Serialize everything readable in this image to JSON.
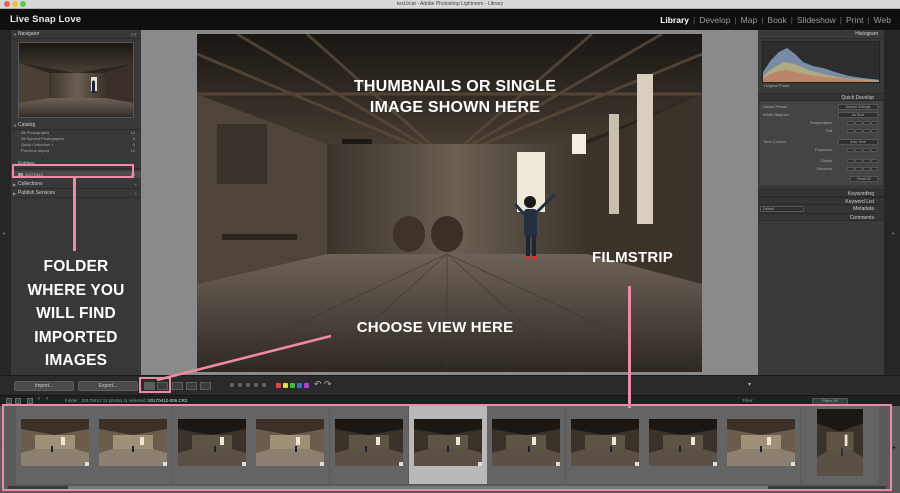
{
  "window": {
    "title": "test.lrcat - Adobe Photoshop Lightroom - Library"
  },
  "identity_plate": "Live Snap Love",
  "modules": [
    {
      "label": "Library",
      "active": true
    },
    {
      "label": "Develop",
      "active": false
    },
    {
      "label": "Map",
      "active": false
    },
    {
      "label": "Book",
      "active": false
    },
    {
      "label": "Slideshow",
      "active": false
    },
    {
      "label": "Print",
      "active": false
    },
    {
      "label": "Web",
      "active": false
    }
  ],
  "left_panel": {
    "navigator": {
      "label": "Navigator",
      "zoom": "FIT"
    },
    "catalog": {
      "label": "Catalog",
      "items": [
        {
          "label": "All Photographs",
          "count": "12"
        },
        {
          "label": "All Synced Photographs",
          "count": "0"
        },
        {
          "label": "Quick Collection +",
          "count": "0"
        },
        {
          "label": "Previous Import",
          "count": "12"
        }
      ]
    },
    "folders": {
      "label": "Folders"
    },
    "folder_item": {
      "label": "20170412",
      "count": "12"
    },
    "collections": {
      "label": "Collections"
    },
    "publish": {
      "label": "Publish Services"
    }
  },
  "toolbar": {
    "import_label": "Import...",
    "export_label": "Export..."
  },
  "right_panel": {
    "histogram": {
      "label": "Histogram"
    },
    "original_photo": "Original Photo",
    "quick_develop": {
      "label": "Quick Develop",
      "saved_preset": "Saved Preset",
      "preset_value": "Default Settings",
      "white_balance": "White Balance",
      "wb_value": "As Shot",
      "temperature": "Temperature",
      "tint": "Tint",
      "tone_control": "Tone Control",
      "tone_value": "Auto Tone",
      "exposure": "Exposure",
      "clarity": "Clarity",
      "vibrance": "Vibrance",
      "reset_all": "Reset All"
    },
    "keywording": "Keywording",
    "keyword_list": "Keyword List",
    "metadata": "Metadata",
    "metadata_preset": "Default",
    "comments": "Comments"
  },
  "filmstrip": {
    "path_prefix": "Folder : 20170412   12 photos /1 selected /",
    "path_file": "20170412-006.CR2",
    "filter_label": "Filter :",
    "filter_value": "Filters Off"
  },
  "annotations": {
    "thumbnails_line1": "THUMBNAILS OR SINGLE",
    "thumbnails_line2": "IMAGE SHOWN HERE",
    "folder_lines": [
      "FOLDER",
      "WHERE YOU",
      "WILL FIND",
      "IMPORTED",
      "IMAGES"
    ],
    "choose_view": "CHOOSE VIEW HERE",
    "filmstrip": "FILMSTRIP",
    "accent_color": "#ee8aa4"
  },
  "label_colors": [
    "#d44",
    "#dd4",
    "#4b4",
    "#46d",
    "#a4c"
  ]
}
